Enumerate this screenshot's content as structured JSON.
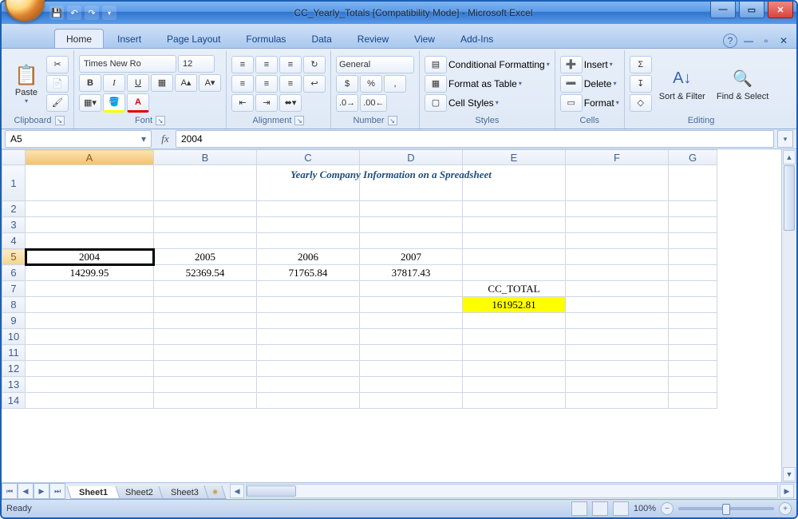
{
  "window": {
    "title": "CC_Yearly_Totals  [Compatibility Mode] - Microsoft Excel"
  },
  "tabs": {
    "home": "Home",
    "insert": "Insert",
    "page_layout": "Page Layout",
    "formulas": "Formulas",
    "data": "Data",
    "review": "Review",
    "view": "View",
    "addins": "Add-Ins"
  },
  "ribbon": {
    "clipboard": {
      "label": "Clipboard",
      "paste": "Paste"
    },
    "font": {
      "label": "Font",
      "name": "Times New Ro",
      "size": "12",
      "bold": "B",
      "italic": "I",
      "underline": "U"
    },
    "alignment": {
      "label": "Alignment"
    },
    "number": {
      "label": "Number",
      "format": "General",
      "currency": "$",
      "percent": "%",
      "comma": ","
    },
    "styles": {
      "label": "Styles",
      "cond": "Conditional Formatting",
      "table": "Format as Table",
      "cell": "Cell Styles"
    },
    "cells": {
      "label": "Cells",
      "insert": "Insert",
      "delete": "Delete",
      "format": "Format"
    },
    "editing": {
      "label": "Editing",
      "sigma": "Σ",
      "sort": "Sort & Filter",
      "find": "Find & Select"
    }
  },
  "formula_bar": {
    "namebox": "A5",
    "fx": "fx",
    "value": "2004"
  },
  "columns": [
    "A",
    "B",
    "C",
    "D",
    "E",
    "F",
    "G"
  ],
  "rows": [
    "1",
    "2",
    "3",
    "4",
    "5",
    "6",
    "7",
    "8",
    "9",
    "10",
    "11",
    "12",
    "13",
    "14"
  ],
  "active_cell": "A5",
  "data": {
    "title": "Yearly Company Information on a Spreadsheet",
    "r5": {
      "A": "2004",
      "B": "2005",
      "C": "2006",
      "D": "2007"
    },
    "r6": {
      "A": "14299.95",
      "B": "52369.54",
      "C": "71765.84",
      "D": "37817.43"
    },
    "r7": {
      "E": "CC_TOTAL"
    },
    "r8": {
      "E": "161952.81"
    }
  },
  "sheets": {
    "s1": "Sheet1",
    "s2": "Sheet2",
    "s3": "Sheet3"
  },
  "status": {
    "ready": "Ready",
    "zoom": "100%"
  },
  "chart_data": {
    "type": "table",
    "title": "Yearly Company Information on a Spreadsheet",
    "categories": [
      "2004",
      "2005",
      "2006",
      "2007"
    ],
    "values": [
      14299.95,
      52369.54,
      71765.84,
      37817.43
    ],
    "total_label": "CC_TOTAL",
    "total": 161952.81
  }
}
